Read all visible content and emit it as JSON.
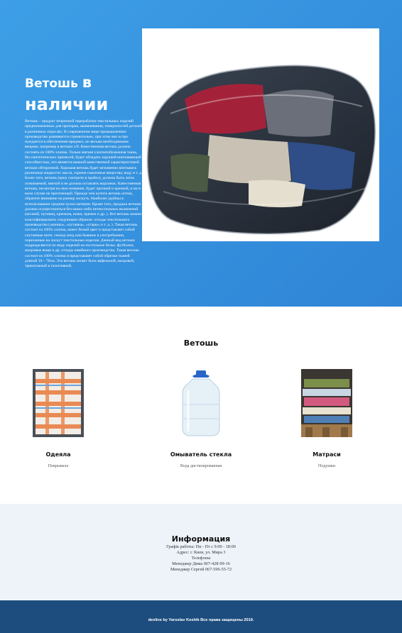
{
  "hero": {
    "title_part1": "Ветошь",
    "title_part2": "в",
    "title_part3": "наличии",
    "description": "Ветошь – продукт вторичной переработки текстильных изделий предназначенных для протирки, вымачивания, поверхностей деталей в различных отраслях. В современном мире промышленное производство развивается стремительно, при этом оно остро нуждается в обеспечении вредных, но весьма необходимыми вещами, например в ветоши х/б. Качественная ветошь должна состоять из 100% хлопка. Только мягкая хлопчатобумажная ткань, без синтетических примесей, будет обладать хорошей впитывающей способностью, что является важной качественной характеристикой ветоши обтирочной. Хорошая ветошь будет мгновенно впитывать различные жидкости: масла, горюче-смазочные вещества, воду и т. д. Более того, ветошь (цену смотрите в прайсе), должна быть легко отжимаемой, мягкой и не должна оставлять ворсинок. Качественная ветошь, несмотря на свое название, будет прочной и крепкой, и ни в коем случае не протлеющей. Прежде чем купить ветошь оптом, обратите внимание на размер лоскуть. Наиболее удобны в использовании средние куски материи. Кроме того, продажа ветоши должна осуществляться без каких-либо нетекстильных включений (молний, пуговиц, крючков, ножи, пряжек и др. ). Вот ветошь можно классифицировать следующим образом: отходы текстильного производства («концы», «путанка», «угары» и т. д. ). Такая ветошь состоит из 100% хлопка, имеет белый цвет и представляет собой спутанные нити. секонд хенд или бывшие в употреблении, порезанные на лоскут текстильные изделия. Данный вид ветоши подразделяется по виду изделий на постельное белье, футболки, махровые вещи и др. отходы швейного производства. Такая ветошь состоит из 100% хлопка и представляет собой обрезки тканей длиной 10 – 70см. Эта ветошь может быть вафельной, махровой, трикотажной и полотняной."
  },
  "products": {
    "title": "Ветошь",
    "items": [
      {
        "name": "Одеяла",
        "subtitle": "Покрывала",
        "icon": "striped-blanket-photo"
      },
      {
        "name": "Омыватель стекла",
        "subtitle": "Вода дистилированная",
        "icon": "water-bottle-photo"
      },
      {
        "name": "Матраси",
        "subtitle": "Подушки",
        "icon": "mattress-stack-photo"
      }
    ]
  },
  "info": {
    "title": "Информация",
    "lines": [
      "Графік работы: Пн - Пт с 9:00 - 18:00",
      "Адрес: г. Киев, ул. Мира 3",
      "Телефоны",
      "Менеджер Дима 067-428-99-16",
      "Менеджер Сергей 067-596-55-72"
    ]
  },
  "footer": {
    "copyright": "dexline by Yaroslav Koshik Все права защищены 2019."
  },
  "colors": {
    "hero_bg": "#3d9fe6",
    "footer_bg": "#1d4d7e",
    "info_bg": "#eef3f9"
  }
}
